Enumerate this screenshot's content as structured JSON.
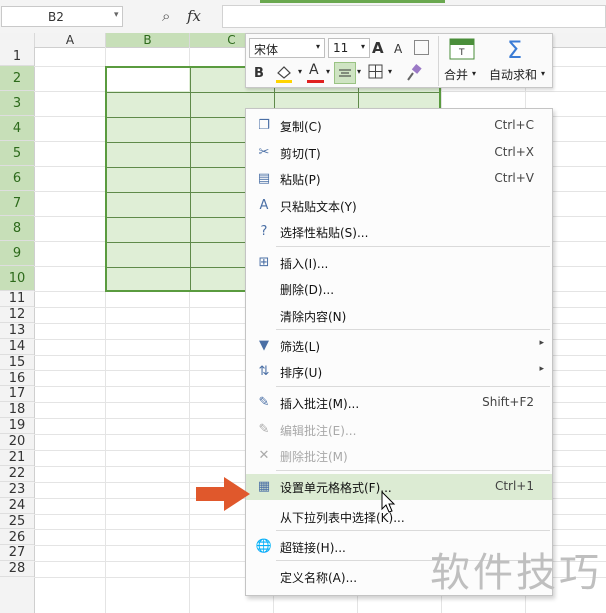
{
  "formula_bar": {
    "name_box": "B2",
    "name_box_arrow": "▾",
    "fx_label": "fx",
    "search_glyph": "⌕"
  },
  "columns": {
    "A": "A",
    "B": "B",
    "C": "C"
  },
  "rows": [
    "1",
    "2",
    "3",
    "4",
    "5",
    "6",
    "7",
    "8",
    "9",
    "10",
    "11",
    "12",
    "13",
    "14",
    "15",
    "16",
    "17",
    "18",
    "19",
    "20",
    "21",
    "22",
    "23",
    "24",
    "25",
    "26",
    "27",
    "28"
  ],
  "mini_toolbar": {
    "font_name": "宋体",
    "font_size": "11",
    "grow_font": "A",
    "shrink_font": "A",
    "bold": "B",
    "font_color_letter": "A",
    "merge_label": "合并",
    "autosum_label": "自动求和",
    "sigma": "Σ",
    "dropdown": "▾"
  },
  "context_menu": {
    "items": [
      {
        "label": "复制(C)",
        "shortcut": "Ctrl+C",
        "icon": "copy-icon",
        "glyph": "❐"
      },
      {
        "label": "剪切(T)",
        "shortcut": "Ctrl+X",
        "icon": "scissors-icon",
        "glyph": "✂"
      },
      {
        "label": "粘贴(P)",
        "shortcut": "Ctrl+V",
        "icon": "paste-icon",
        "glyph": "▤"
      },
      {
        "label": "只粘贴文本(Y)",
        "icon": "paste-text-icon",
        "glyph": "A"
      },
      {
        "label": "选择性粘贴(S)...",
        "icon": "paste-special-icon",
        "glyph": "?"
      },
      {
        "label": "插入(I)...",
        "icon": "insert-icon",
        "glyph": "⊞"
      },
      {
        "label": "删除(D)..."
      },
      {
        "label": "清除内容(N)"
      },
      {
        "label": "筛选(L)",
        "icon": "filter-icon",
        "glyph": "▼",
        "submenu": "▸"
      },
      {
        "label": "排序(U)",
        "icon": "sort-icon",
        "glyph": "⇅",
        "submenu": "▸"
      },
      {
        "label": "插入批注(M)...",
        "shortcut": "Shift+F2",
        "icon": "insert-comment-icon",
        "glyph": "✎"
      },
      {
        "label": "编辑批注(E)...",
        "icon": "edit-comment-icon",
        "glyph": "✎",
        "disabled": true
      },
      {
        "label": "删除批注(M)",
        "icon": "delete-comment-icon",
        "glyph": "✕",
        "disabled": true
      },
      {
        "label": "设置单元格格式(F)...",
        "shortcut": "Ctrl+1",
        "icon": "format-cells-icon",
        "glyph": "▦"
      },
      {
        "label": "从下拉列表中选择(K)..."
      },
      {
        "label": "超链接(H)...",
        "icon": "hyperlink-icon",
        "glyph": "🌐"
      },
      {
        "label": "定义名称(A)..."
      }
    ]
  },
  "watermark": "软件技巧",
  "colors": {
    "selection_border": "#5a9b3f",
    "header_selected": "#c7dfb8",
    "menu_hover": "#dcebd3",
    "arrow": "#e0582c"
  }
}
